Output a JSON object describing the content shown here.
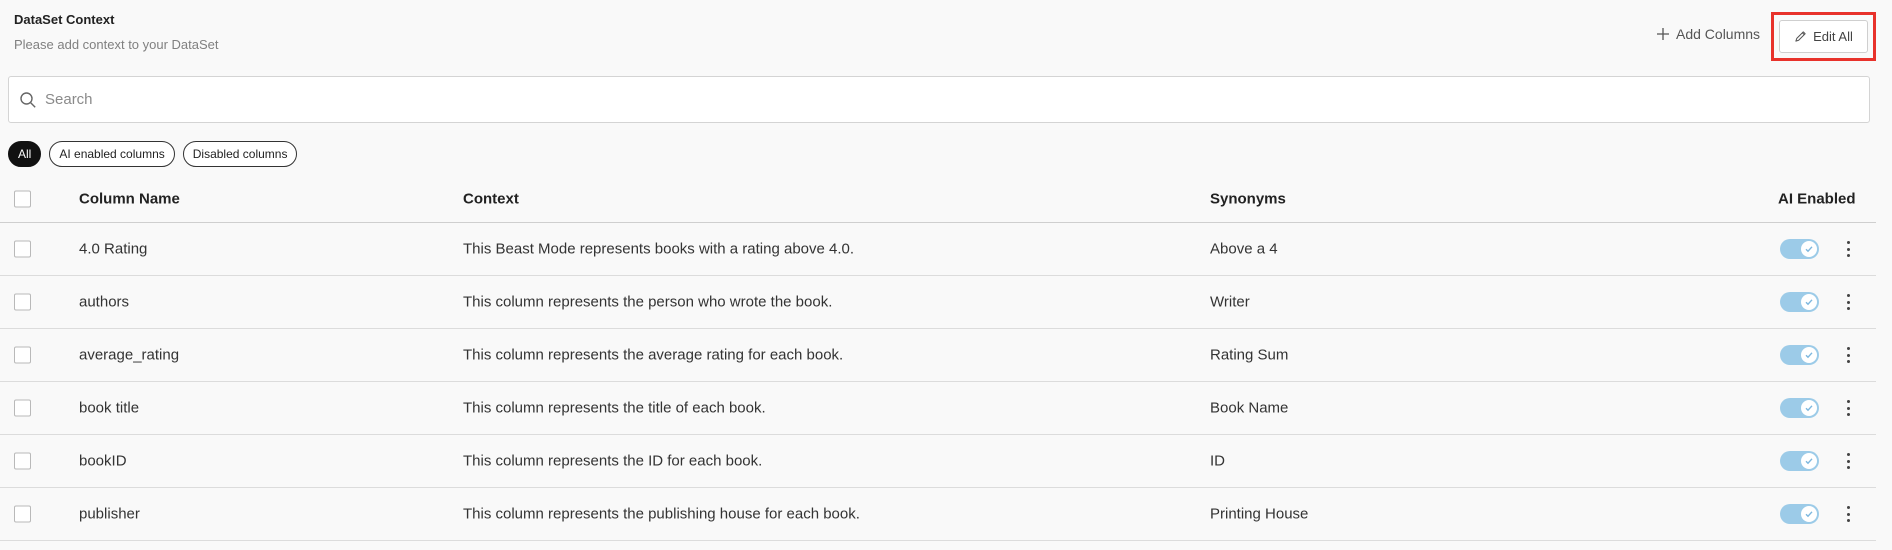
{
  "header": {
    "title": "DataSet Context",
    "subtitle": "Please add context to your DataSet"
  },
  "toolbar": {
    "add_columns_label": "Add Columns",
    "edit_all_label": "Edit All"
  },
  "search": {
    "placeholder": "Search",
    "value": ""
  },
  "filters": [
    {
      "label": "All",
      "active": true
    },
    {
      "label": "AI enabled columns",
      "active": false
    },
    {
      "label": "Disabled columns",
      "active": false
    }
  ],
  "table": {
    "columns": {
      "name": "Column Name",
      "context": "Context",
      "synonyms": "Synonyms",
      "ai_enabled": "AI Enabled"
    },
    "rows": [
      {
        "name": "4.0 Rating",
        "context": "This Beast Mode represents books with a rating above 4.0.",
        "synonyms": "Above a 4",
        "ai_enabled": true
      },
      {
        "name": "authors",
        "context": "This column represents the person who wrote the book.",
        "synonyms": "Writer",
        "ai_enabled": true
      },
      {
        "name": "average_rating",
        "context": "This column represents the average rating for each book.",
        "synonyms": "Rating Sum",
        "ai_enabled": true
      },
      {
        "name": "book title",
        "context": "This column represents the title of each book.",
        "synonyms": "Book Name",
        "ai_enabled": true
      },
      {
        "name": "bookID",
        "context": "This column represents the ID for each book.",
        "synonyms": "ID",
        "ai_enabled": true
      },
      {
        "name": "publisher",
        "context": "This column represents the publishing house for each book.",
        "synonyms": "Printing House",
        "ai_enabled": true
      }
    ]
  },
  "colors": {
    "highlight": "#e8322b",
    "toggle_on": "#9ccbe8",
    "chip_active": "#111111"
  },
  "icons": {
    "add": "plus-icon",
    "edit": "pencil-icon",
    "search": "search-icon",
    "toggle_check": "check-icon",
    "more": "kebab-menu-icon"
  }
}
